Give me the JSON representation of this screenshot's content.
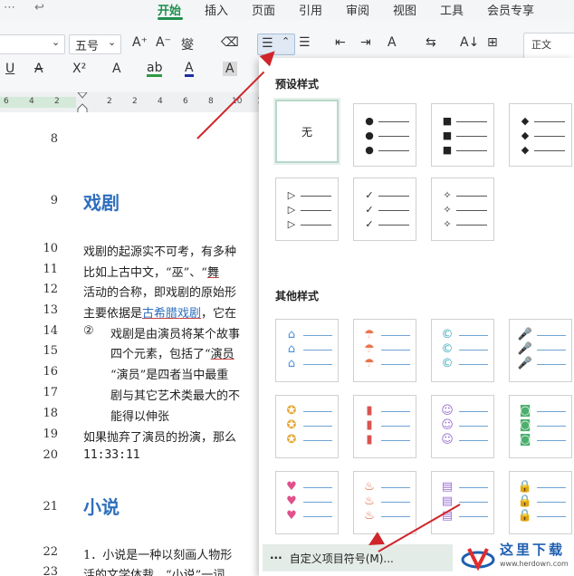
{
  "menu": {
    "items": [
      "开始",
      "插入",
      "页面",
      "引用",
      "审阅",
      "视图",
      "工具",
      "会员专享"
    ],
    "active": "开始",
    "left_glyphs": [
      "⋯",
      "↩"
    ]
  },
  "toolbar": {
    "font_size": "五号",
    "ruler_numbers": [
      "6",
      "4",
      "2",
      "2",
      "2",
      "4",
      "6",
      "8",
      "10",
      "12"
    ],
    "style_preview": "正文",
    "row1_glyphs": [
      "A⁺",
      "A⁻",
      "燮",
      "⌫",
      "☰",
      "☰",
      "⇤",
      "⇥",
      "A",
      "⇆",
      "A↓",
      "⊞"
    ],
    "row2_glyphs": [
      "U",
      "A",
      "X²",
      "A",
      "ab",
      "A",
      "A"
    ]
  },
  "document": {
    "lines": [
      {
        "num": "8",
        "text": ""
      },
      {
        "num": "9",
        "heading": "戏剧"
      },
      {
        "num": "10",
        "text": "戏剧的起源实不可考，有多种"
      },
      {
        "num": "11",
        "text_a": "比如上古中文，“巫”、“",
        "text_b": "舞"
      },
      {
        "num": "12",
        "text": "活动的合称，即戏剧的原始形"
      },
      {
        "num": "13",
        "text_a": "主要依据是",
        "text_b": "古希腊戏剧",
        "text_c": "，它在"
      },
      {
        "num": "14",
        "marker": "②",
        "text": "戏剧是由演员将某个故事"
      },
      {
        "num": "15",
        "text_a": "四个元素，包括了“",
        "text_b": "演员"
      },
      {
        "num": "16",
        "text": "“演员”是四者当中最重"
      },
      {
        "num": "17",
        "text": "剧与其它艺术类最大的不"
      },
      {
        "num": "18",
        "text": "能得以伸张"
      },
      {
        "num": "19",
        "text": "如果抛弃了演员的扮演，那么"
      },
      {
        "num": "20",
        "text": "11:33:11"
      },
      {
        "num": "21",
        "heading": "小说"
      },
      {
        "num": "22",
        "text": "1．小说是一种以刻画人物形"
      },
      {
        "num": "23",
        "text": "活的文学体裁，“小说”一词"
      }
    ]
  },
  "panel": {
    "preset_title": "预设样式",
    "none_label": "无",
    "preset_bullets": [
      "●",
      "■",
      "◆",
      "▷",
      "✓",
      "✧"
    ],
    "other_title": "其他样式",
    "other_bullets": [
      {
        "icon": "house-icon",
        "glyph": "⌂",
        "color": "#4a90d9"
      },
      {
        "icon": "umbrella-icon",
        "glyph": "☂",
        "color": "#e8734a"
      },
      {
        "icon": "copyright-icon",
        "glyph": "©",
        "color": "#3aa6b9"
      },
      {
        "icon": "microphone-icon",
        "glyph": "🎤",
        "color": "#e58f86"
      },
      {
        "icon": "check-badge-icon",
        "glyph": "✪",
        "color": "#e6a93a"
      },
      {
        "icon": "battery-icon",
        "glyph": "▮",
        "color": "#d9534f"
      },
      {
        "icon": "smiley-icon",
        "glyph": "☺",
        "color": "#9b6fd1"
      },
      {
        "icon": "camera-icon",
        "glyph": "◙",
        "color": "#4caf6d"
      },
      {
        "icon": "heart-icon",
        "glyph": "♥",
        "color": "#e0508a"
      },
      {
        "icon": "flame-icon",
        "glyph": "♨",
        "color": "#e35d3b"
      },
      {
        "icon": "bookmark-icon",
        "glyph": "▤",
        "color": "#9b6fd1"
      },
      {
        "icon": "lock-icon",
        "glyph": "🔒",
        "color": "#4caf6d"
      }
    ],
    "custom_label": "自定义项目符号(M)...",
    "custom_glyph": "···"
  },
  "watermark": {
    "text": "这里下载",
    "url_text": "www.herdown.com"
  },
  "colors": {
    "accent": "#1f8f4e",
    "heading": "#2e6fbd",
    "arrow": "#d0252a"
  }
}
